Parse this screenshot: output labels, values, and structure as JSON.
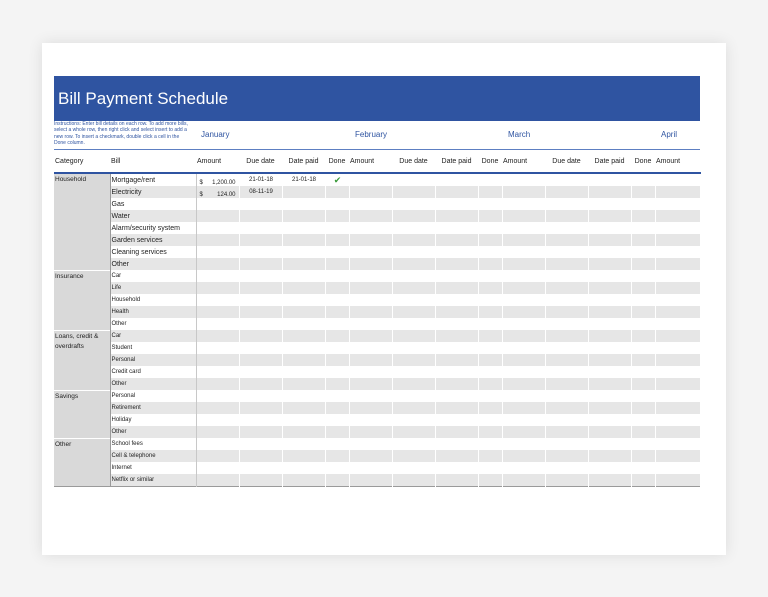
{
  "title": "Bill Payment Schedule",
  "instructions": "Instructions: Enter bill details on each row. To add more bills, select a whole row, then right click and select insert to add a new row. To insert a checkmark, double click a cell in the Done column.",
  "months": [
    "January",
    "February",
    "March",
    "April"
  ],
  "columns": {
    "category": "Category",
    "bill": "Bill",
    "amount": "Amount",
    "due_date": "Due date",
    "date_paid": "Date paid",
    "done": "Done"
  },
  "categories": [
    {
      "name": "Household",
      "bills": [
        {
          "name": "Mortgage/rent",
          "currency": "$",
          "amount": "1,200.00",
          "due": "21-01-18",
          "paid": "21-01-18",
          "done": true
        },
        {
          "name": "Electricity",
          "currency": "$",
          "amount": "124.00",
          "due": "08-11-19",
          "paid": "",
          "done": false
        },
        {
          "name": "Gas"
        },
        {
          "name": "Water"
        },
        {
          "name": "Alarm/security system"
        },
        {
          "name": "Garden services"
        },
        {
          "name": "Cleaning services"
        },
        {
          "name": "Other"
        }
      ]
    },
    {
      "name": "Insurance",
      "bills": [
        {
          "name": "Car"
        },
        {
          "name": "Life"
        },
        {
          "name": "Household"
        },
        {
          "name": "Health"
        },
        {
          "name": "Other"
        }
      ]
    },
    {
      "name": "Loans, credit & overdrafts",
      "bills": [
        {
          "name": "Car"
        },
        {
          "name": "Student"
        },
        {
          "name": "Personal"
        },
        {
          "name": "Credit card"
        },
        {
          "name": "Other"
        }
      ]
    },
    {
      "name": "Savings",
      "bills": [
        {
          "name": "Personal"
        },
        {
          "name": "Retirement"
        },
        {
          "name": "Holiday"
        },
        {
          "name": "Other"
        }
      ]
    },
    {
      "name": "Other",
      "bills": [
        {
          "name": "School fees"
        },
        {
          "name": "Cell & telephone"
        },
        {
          "name": "Internet"
        },
        {
          "name": "Netflix or similar"
        }
      ]
    }
  ],
  "check_glyph": "✔",
  "colors": {
    "header_blue": "#2f54a1",
    "check_green": "#3a9a3a"
  }
}
